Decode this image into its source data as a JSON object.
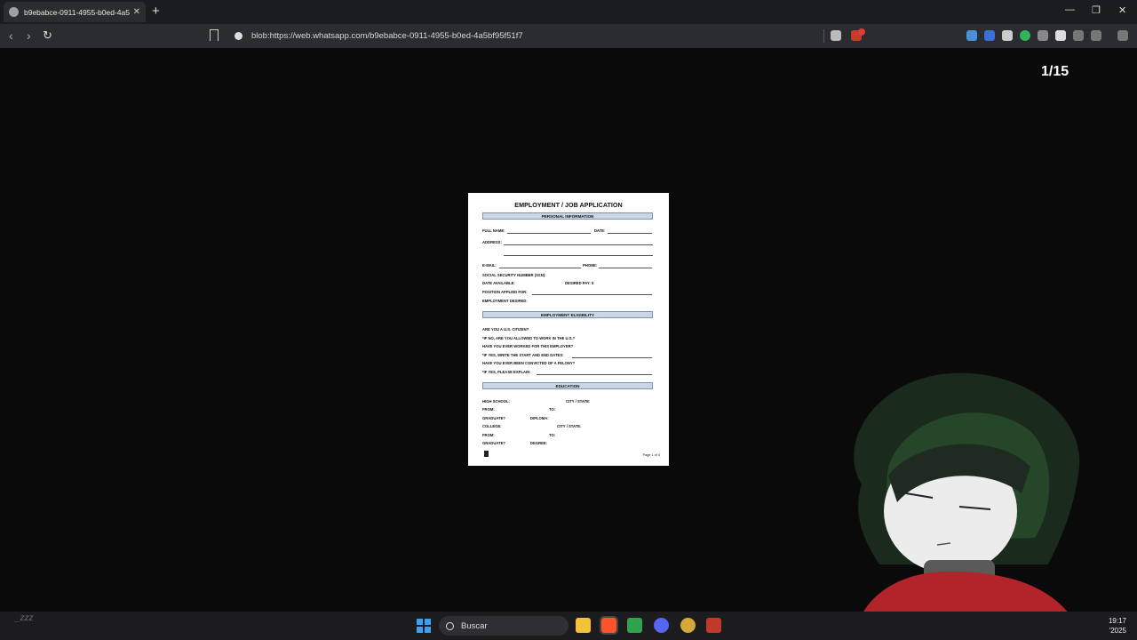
{
  "browser": {
    "tab": {
      "title": "b9ebabce-0911-4955-b0ed-4a5"
    },
    "new_tab_label": "+",
    "window_controls": {
      "minimize": "—",
      "restore": "❐",
      "close": "✕"
    },
    "url": "blob:https://web.whatsapp.com/b9ebabce-0911-4955-b0ed-4a5bf95f51f7"
  },
  "viewer": {
    "page_counter": "1/15",
    "document": {
      "title": "EMPLOYMENT / JOB APPLICATION",
      "sections": {
        "personal": "PERSONAL INFORMATION",
        "eligibility": "EMPLOYMENT ELIGIBILITY",
        "education": "EDUCATION"
      },
      "fields": {
        "full_name": "FULL NAME:",
        "date": "DATE:",
        "address": "ADDRESS:",
        "email": "E-MAIL:",
        "phone": "PHONE:",
        "ssn": "SOCIAL SECURITY NUMBER (SSN):",
        "date_available": "DATE AVAILABLE:",
        "desired_pay": "DESIRED PAY: $",
        "position": "POSITION APPLIED FOR:",
        "employment_desired": "EMPLOYMENT DESIRED:",
        "citizen": "ARE YOU A U.S. CITIZEN?",
        "allowed": "*IF NO, ARE YOU ALLOWED TO WORK IN THE U.S.?",
        "worked_before": "HAVE YOU EVER WORKED FOR THIS EMPLOYER?",
        "dates": "*IF YES, WRITE THE START AND END DATES:",
        "felony": "HAVE YOU EVER BEEN CONVICTED OF A FELONY?",
        "explain": "*IF YES, PLEASE EXPLAIN:",
        "high_school": "HIGH SCHOOL:",
        "city_state_hs": "CITY / STATE:",
        "from_1": "FROM:",
        "to_1": "TO:",
        "graduate_1": "GRADUATE?",
        "diploma": "DIPLOMA:",
        "college": "COLLEGE:",
        "city_state_col": "CITY / STATE:",
        "from_2": "FROM:",
        "to_2": "TO:",
        "graduate_2": "GRADUATE?",
        "degree": "DEGREE:"
      },
      "footer": "Page 1 of 4"
    }
  },
  "taskbar": {
    "status_text": "_zzz",
    "search_label": "Buscar",
    "clock_time": "19:17",
    "clock_date": "'2025"
  },
  "colors": {
    "accent_blue": "#3aa0f0",
    "brave_orange": "#fb542b",
    "badge_red": "#e03c31"
  }
}
